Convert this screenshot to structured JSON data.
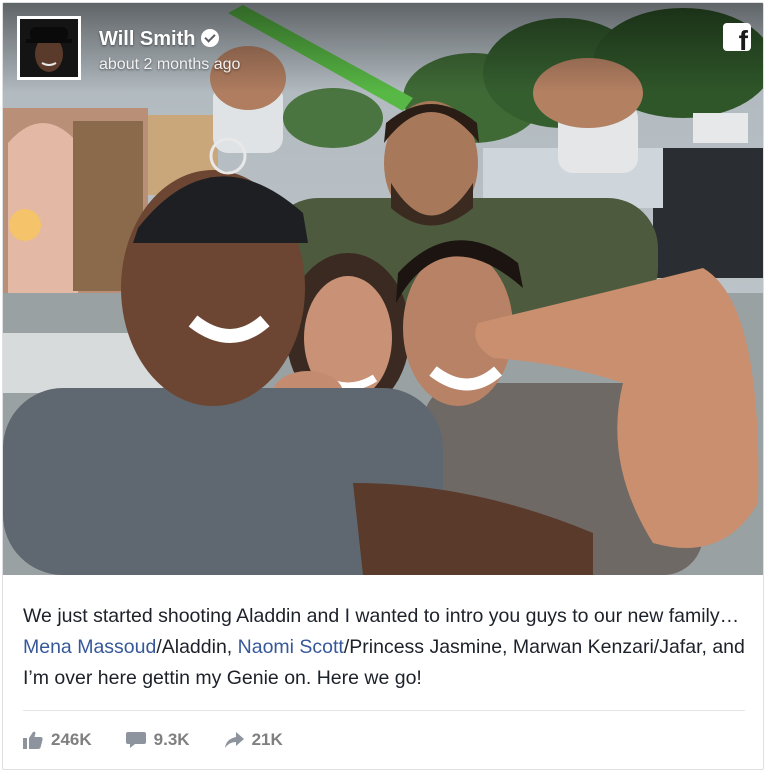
{
  "post": {
    "author": "Will Smith",
    "timestamp": "about 2 months ago",
    "platform_icon": "facebook-logo-icon",
    "text_parts": {
      "p1": "We just started shooting Aladdin and I wanted to intro you guys to our new family… ",
      "mention1": "Mena Massoud",
      "p2": "/Aladdin, ",
      "mention2": "Naomi Scott",
      "p3": "/Princess Jasmine, Marwan Kenzari/Jafar, and I’m over here gettin my Genie on. Here we go!"
    },
    "link_color": "#365899"
  },
  "stats": {
    "likes": "246K",
    "comments": "9.3K",
    "shares": "21K"
  }
}
